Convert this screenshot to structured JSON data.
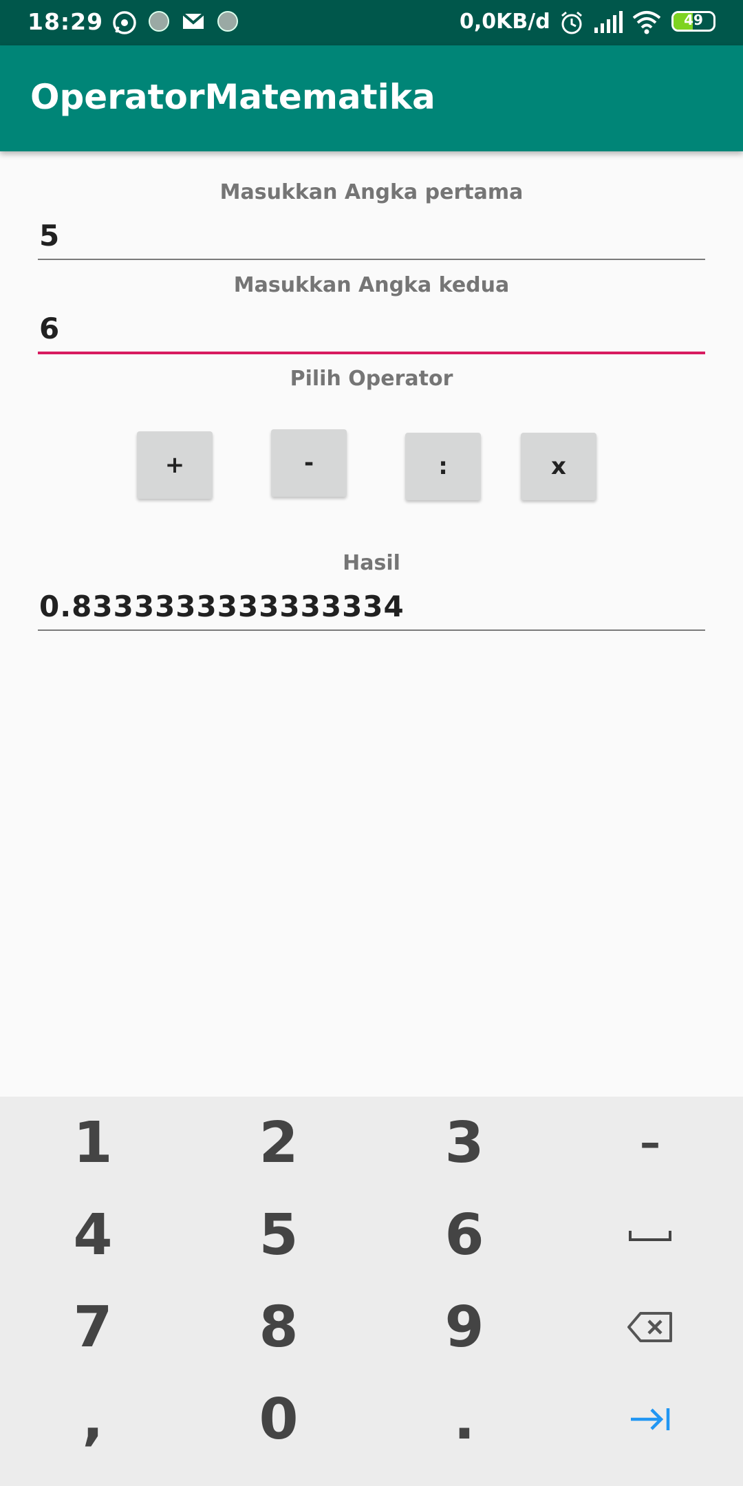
{
  "status_bar": {
    "time": "18:29",
    "network_speed": "0,0KB/d",
    "battery_level": "49",
    "icons": [
      "whatsapp-icon",
      "app-icon",
      "gmail-icon",
      "app-icon",
      "alarm-icon",
      "signal-icon",
      "wifi-icon",
      "battery-icon"
    ]
  },
  "app_bar": {
    "title": "OperatorMatematika"
  },
  "form": {
    "first_label": "Masukkan Angka pertama",
    "first_value": "5",
    "second_label": "Masukkan Angka kedua",
    "second_value": "6",
    "operator_label": "Pilih Operator",
    "operators": [
      "+",
      "-",
      ":",
      "x"
    ],
    "result_label": "Hasil",
    "result_value": "0.8333333333333334"
  },
  "keyboard": {
    "keys": [
      "1",
      "2",
      "3",
      "–",
      "4",
      "5",
      "6",
      "space-icon",
      "7",
      "8",
      "9",
      "backspace-icon",
      ",",
      "0",
      ".",
      "next-icon"
    ]
  },
  "colors": {
    "status_bar": "#00574b",
    "app_bar": "#008577",
    "accent": "#d81b60",
    "keyboard_bg": "#ececec",
    "next_key": "#2196f3"
  }
}
